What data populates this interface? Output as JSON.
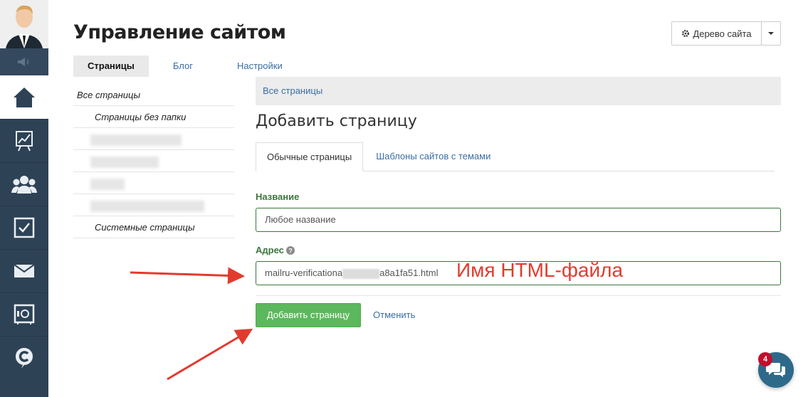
{
  "header": {
    "title": "Управление сайтом"
  },
  "site_tree_button": {
    "label": "Дерево сайта",
    "icon": "gear-icon"
  },
  "tabs": [
    {
      "label": "Страницы",
      "active": true
    },
    {
      "label": "Блог",
      "active": false
    },
    {
      "label": "Настройки",
      "active": false
    }
  ],
  "left_nav": {
    "all_pages": "Все страницы",
    "no_folder": "Страницы без папки",
    "system_pages": "Системные страницы"
  },
  "breadcrumb": "Все страницы",
  "form": {
    "title": "Добавить страницу",
    "subtabs": [
      {
        "label": "Обычные страницы",
        "active": true
      },
      {
        "label": "Шаблоны сайтов с темами",
        "active": false
      }
    ],
    "name_label": "Название",
    "name_value": "Любое название",
    "address_label": "Адрес",
    "address_value_start": "mailru-verificationa",
    "address_value_end": "a8a1fa51.html",
    "submit_label": "Добавить страницу",
    "cancel_label": "Отменить"
  },
  "annotation_text": "Имя HTML-файла",
  "chat": {
    "badge": "4"
  },
  "colors": {
    "sidebar": "#2e4256",
    "accent_link": "#3a6ea5",
    "success": "#5cb85c",
    "label_green": "#3c763d",
    "annotation_red": "#e23b2e"
  }
}
